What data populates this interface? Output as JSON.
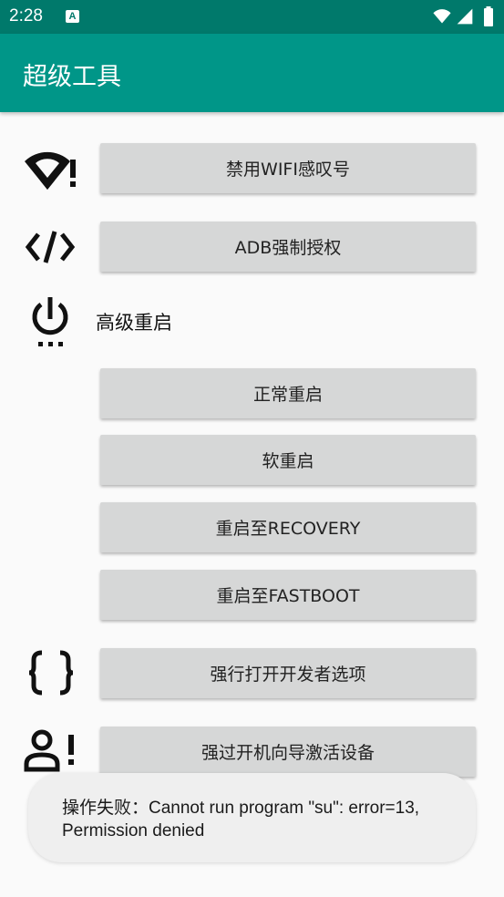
{
  "status_bar": {
    "time": "2:28",
    "notification_icon": "a-icon",
    "icons": [
      "wifi-icon",
      "signal-icon",
      "battery-icon"
    ]
  },
  "app_bar": {
    "title": "超级工具"
  },
  "rows": {
    "wifi": {
      "icon": "wifi-alert-icon",
      "button_label": "禁用WIFI感叹号"
    },
    "adb": {
      "icon": "code-icon",
      "button_label": "ADB强制授权"
    },
    "reboot": {
      "icon": "power-settings-icon",
      "label": "高级重启",
      "buttons": [
        "正常重启",
        "软重启",
        "重启至RECOVERY",
        "重启至FASTBOOT"
      ]
    },
    "dev_options": {
      "icon": "braces-icon",
      "button_label": "强行打开开发者选项"
    },
    "setup_wizard": {
      "icon": "account-alert-icon",
      "button_label": "强过开机向导激活设备"
    }
  },
  "toast": {
    "message": "操作失败：Cannot run program \"su\": error=13, Permission denied"
  },
  "colors": {
    "status_bar": "#00796b",
    "app_bar": "#009688",
    "background": "#fafafa",
    "button": "#d6d7d7",
    "toast": "#efefef"
  }
}
